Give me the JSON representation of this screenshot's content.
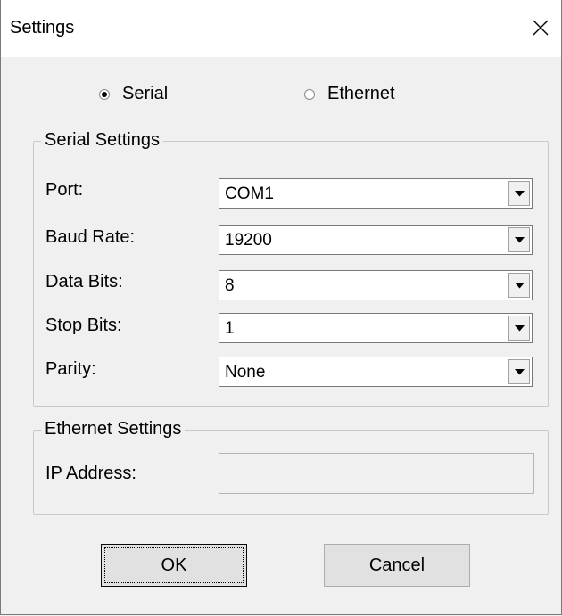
{
  "window": {
    "title": "Settings"
  },
  "mode": {
    "serial_label": "Serial",
    "ethernet_label": "Ethernet",
    "selected": "Serial"
  },
  "serial_settings": {
    "group_label": "Serial Settings",
    "fields": [
      {
        "label": "Port:",
        "value": "COM1"
      },
      {
        "label": "Baud Rate:",
        "value": "19200"
      },
      {
        "label": "Data Bits:",
        "value": "8"
      },
      {
        "label": "Stop Bits:",
        "value": "1"
      },
      {
        "label": "Parity:",
        "value": "None"
      }
    ]
  },
  "ethernet_settings": {
    "group_label": "Ethernet Settings",
    "ip_label": "IP Address:",
    "ip_value": ""
  },
  "buttons": {
    "ok_label": "OK",
    "cancel_label": "Cancel"
  },
  "icons": {
    "close": "close-icon",
    "dropdown": "chevron-down-icon"
  }
}
